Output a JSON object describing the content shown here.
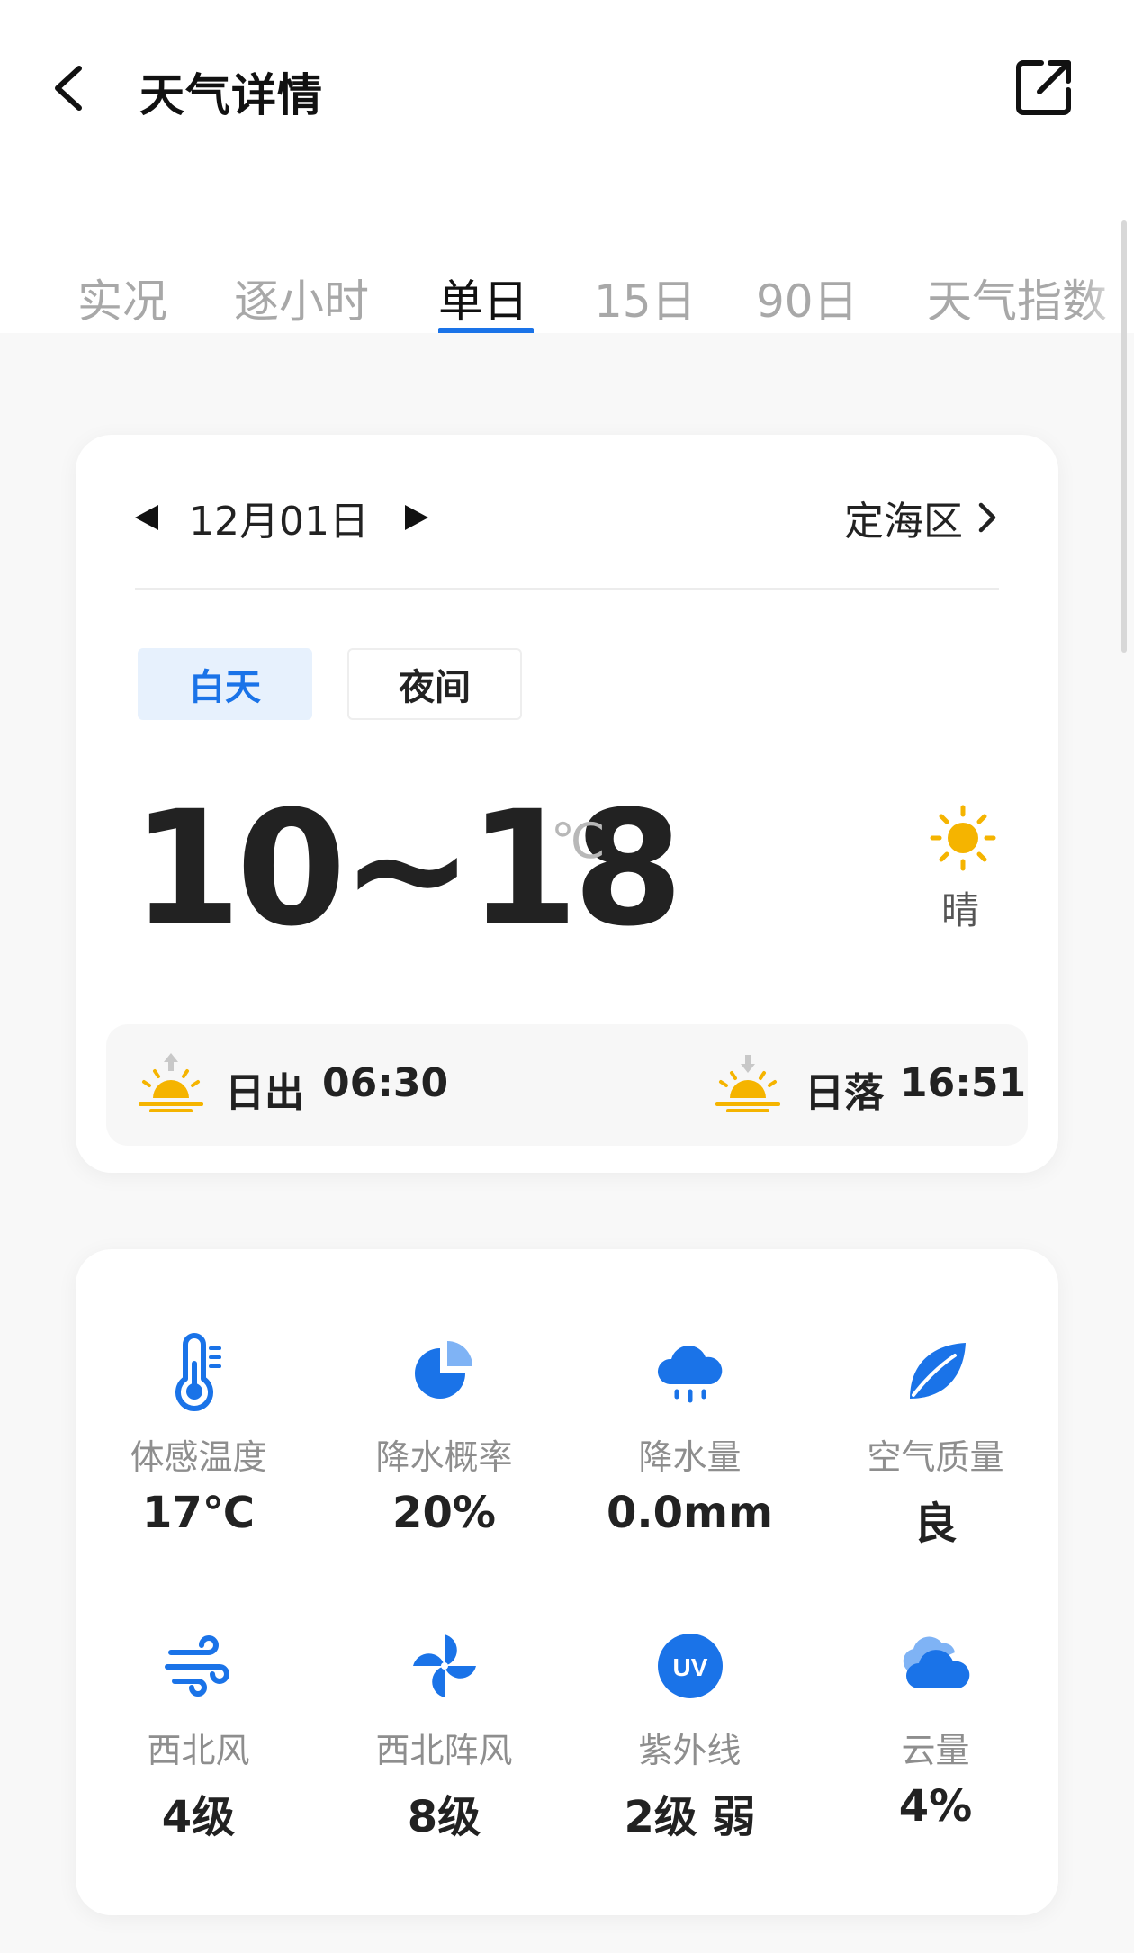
{
  "header": {
    "title": "天气详情",
    "back_icon": "chevron-left-icon",
    "share_icon": "external-link-icon"
  },
  "tabs": [
    {
      "label": "实况",
      "active": false
    },
    {
      "label": "逐小时",
      "active": false
    },
    {
      "label": "单日",
      "active": true
    },
    {
      "label": "15日",
      "active": false
    },
    {
      "label": "90日",
      "active": false
    },
    {
      "label": "天气指数",
      "active": false
    }
  ],
  "day": {
    "date": "12月01日",
    "location": "定海区",
    "segments": {
      "day": "白天",
      "night": "夜间",
      "selected": "day"
    },
    "temp_range": "10~18",
    "temp_unit": "℃",
    "condition": "晴",
    "condition_icon": "sun-icon",
    "sunrise_label": "日出",
    "sunrise_time": "06:30",
    "sunset_label": "日落",
    "sunset_time": "16:51"
  },
  "metrics": [
    {
      "icon": "thermometer-icon",
      "label": "体感温度",
      "value": "17℃"
    },
    {
      "icon": "pie-chart-icon",
      "label": "降水概率",
      "value": "20%"
    },
    {
      "icon": "rain-cloud-icon",
      "label": "降水量",
      "value": "0.0mm"
    },
    {
      "icon": "leaf-icon",
      "label": "空气质量",
      "value": "良"
    },
    {
      "icon": "wind-icon",
      "label": "西北风",
      "value": "4级"
    },
    {
      "icon": "pinwheel-icon",
      "label": "西北阵风",
      "value": "8级"
    },
    {
      "icon": "uv-icon",
      "label": "紫外线",
      "value": "2级 弱",
      "badge": "UV"
    },
    {
      "icon": "cloud-icon",
      "label": "云量",
      "value": "4%"
    }
  ],
  "colors": {
    "accent": "#1a73e8",
    "icon_blue": "#1a73e8",
    "sun": "#f5b400",
    "segment_active_bg": "#e7f1fd"
  }
}
